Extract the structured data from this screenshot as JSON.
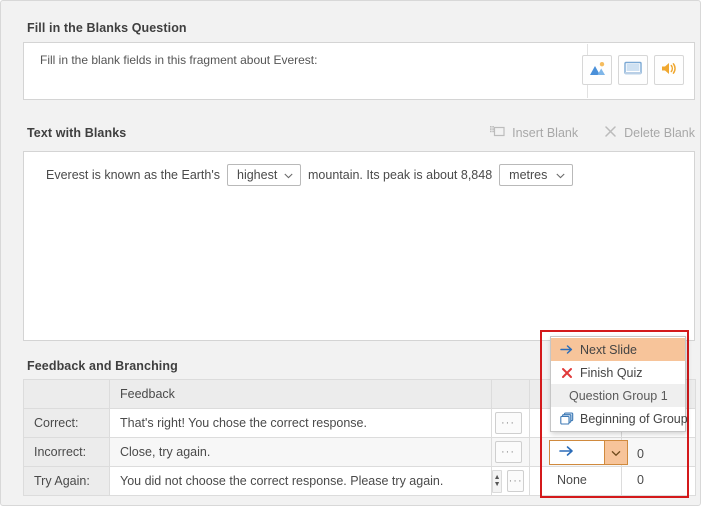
{
  "sections": {
    "question": {
      "title": "Fill in the Blanks Question",
      "text": "Fill in the blank fields in this fragment about Everest:",
      "media_buttons": [
        {
          "name": "image-icon",
          "tooltip": "Image"
        },
        {
          "name": "video-icon",
          "tooltip": "Video"
        },
        {
          "name": "audio-icon",
          "tooltip": "Audio"
        }
      ]
    },
    "blanks": {
      "title": "Text with Blanks",
      "actions": [
        {
          "label": "Insert Blank",
          "icon": "insert-blank-icon",
          "enabled": false
        },
        {
          "label": "Delete Blank",
          "icon": "delete-blank-icon",
          "enabled": false
        }
      ],
      "sentence": {
        "part1": "Everest is known as the Earth's",
        "blank1": "highest",
        "part2": "mountain. Its peak is about 8,848",
        "blank2": "metres"
      }
    },
    "feedback": {
      "title": "Feedback and Branching",
      "columns": {
        "label": "",
        "feedback": "Feedback",
        "more": "",
        "branch": "",
        "score": ""
      },
      "rows": [
        {
          "label": "Correct:",
          "feedback": "That's right! You chose the correct response.",
          "more": "···",
          "has_spinner": false
        },
        {
          "label": "Incorrect:",
          "feedback": "Close, try again.",
          "more": "···",
          "has_spinner": false
        },
        {
          "label": "Try Again:",
          "feedback": "You did not choose the correct response. Please try again.",
          "more": "···",
          "has_spinner": true
        }
      ]
    }
  },
  "branching_dropdown": {
    "open": true,
    "highlight_color": "#d4191b",
    "selected_color": "#f7c49a",
    "items": [
      {
        "label": "Next Slide",
        "icon": "arrow-right-icon",
        "selected": true,
        "is_group_header": false
      },
      {
        "label": "Finish Quiz",
        "icon": "x-mark-icon",
        "selected": false,
        "is_group_header": false
      },
      {
        "label": "Question Group 1",
        "icon": "",
        "selected": false,
        "is_group_header": true
      },
      {
        "label": "Beginning of Group",
        "icon": "group-copy-icon",
        "selected": false,
        "is_group_header": false
      }
    ],
    "combobox": {
      "value_icon": "arrow-right-icon",
      "value": "",
      "caret": "chevron-down-icon"
    },
    "score_values": [
      "0",
      "0"
    ],
    "none_label": "None"
  }
}
